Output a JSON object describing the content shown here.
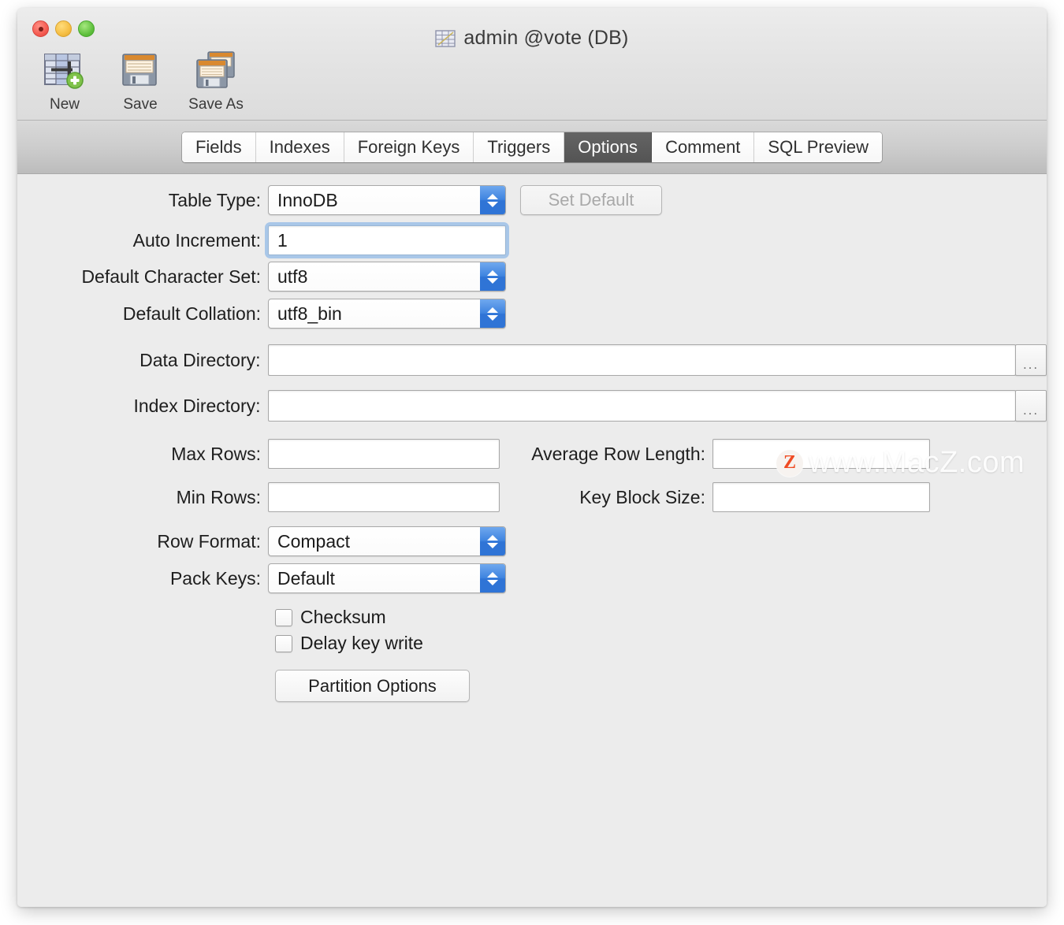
{
  "window": {
    "title": "admin @vote (DB)",
    "title_icon": "table-icon",
    "traffic_lights": [
      "close-button",
      "minimize-button",
      "zoom-button"
    ]
  },
  "toolbar": {
    "items": [
      {
        "label": "New",
        "icon": "new-table-icon"
      },
      {
        "label": "Save",
        "icon": "save-floppy-icon"
      },
      {
        "label": "Save As",
        "icon": "save-as-floppy-icon"
      }
    ]
  },
  "tabs": {
    "items": [
      {
        "label": "Fields",
        "active": false
      },
      {
        "label": "Indexes",
        "active": false
      },
      {
        "label": "Foreign Keys",
        "active": false
      },
      {
        "label": "Triggers",
        "active": false
      },
      {
        "label": "Options",
        "active": true
      },
      {
        "label": "Comment",
        "active": false
      },
      {
        "label": "SQL Preview",
        "active": false
      }
    ]
  },
  "form": {
    "table_type": {
      "label": "Table Type:",
      "value": "InnoDB",
      "control": "popup-button"
    },
    "set_default": {
      "label": "Set Default",
      "enabled": false,
      "control": "push-button"
    },
    "auto_increment": {
      "label": "Auto Increment:",
      "value": "1",
      "control": "text-field",
      "focused": true
    },
    "default_charset": {
      "label": "Default Character Set:",
      "value": "utf8",
      "control": "popup-button"
    },
    "default_collation": {
      "label": "Default Collation:",
      "value": "utf8_bin",
      "control": "popup-button"
    },
    "data_directory": {
      "label": "Data Directory:",
      "value": "",
      "control": "text-field",
      "browse": "..."
    },
    "index_directory": {
      "label": "Index Directory:",
      "value": "",
      "control": "text-field",
      "browse": "..."
    },
    "max_rows": {
      "label": "Max Rows:",
      "value": "",
      "control": "text-field"
    },
    "average_row_length": {
      "label": "Average Row Length:",
      "value": "",
      "control": "text-field"
    },
    "min_rows": {
      "label": "Min Rows:",
      "value": "",
      "control": "text-field"
    },
    "key_block_size": {
      "label": "Key Block Size:",
      "value": "",
      "control": "text-field"
    },
    "row_format": {
      "label": "Row Format:",
      "value": "Compact",
      "control": "popup-button"
    },
    "pack_keys": {
      "label": "Pack Keys:",
      "value": "Default",
      "control": "popup-button"
    },
    "checksum": {
      "label": "Checksum",
      "checked": false,
      "control": "checkbox"
    },
    "delay_key_write": {
      "label": "Delay key write",
      "checked": false,
      "control": "checkbox"
    },
    "partition_options": {
      "label": "Partition Options",
      "control": "push-button"
    }
  },
  "watermark": {
    "logo": "Z",
    "text": "www.MacZ.com"
  },
  "colors": {
    "accent_blue": "#2f74d6",
    "active_tab": "#5a5a5a",
    "window_bg": "#ececec",
    "tabbar_bg": "#cdcdcd",
    "watermark_orange": "#ef4b23"
  }
}
